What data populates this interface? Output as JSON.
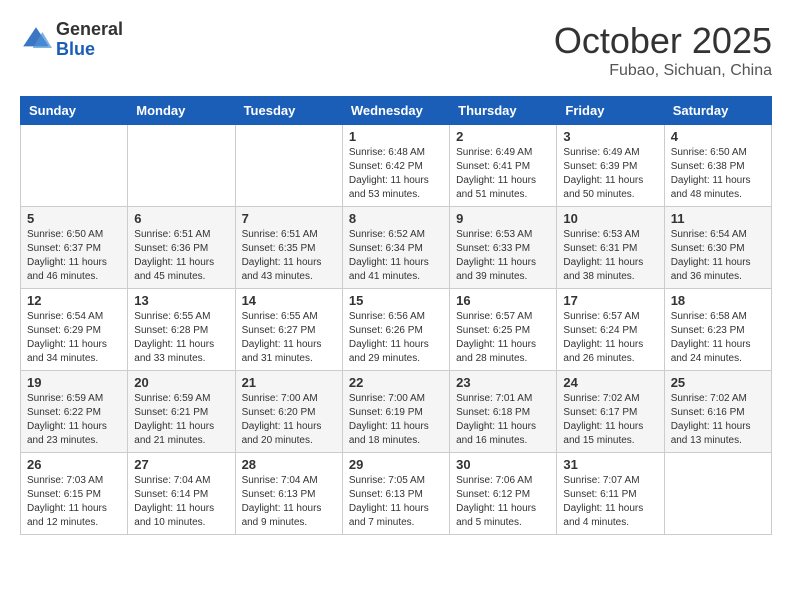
{
  "header": {
    "logo_general": "General",
    "logo_blue": "Blue",
    "title": "October 2025",
    "subtitle": "Fubao, Sichuan, China"
  },
  "days_of_week": [
    "Sunday",
    "Monday",
    "Tuesday",
    "Wednesday",
    "Thursday",
    "Friday",
    "Saturday"
  ],
  "weeks": [
    [
      {
        "day": "",
        "info": ""
      },
      {
        "day": "",
        "info": ""
      },
      {
        "day": "",
        "info": ""
      },
      {
        "day": "1",
        "info": "Sunrise: 6:48 AM\nSunset: 6:42 PM\nDaylight: 11 hours\nand 53 minutes."
      },
      {
        "day": "2",
        "info": "Sunrise: 6:49 AM\nSunset: 6:41 PM\nDaylight: 11 hours\nand 51 minutes."
      },
      {
        "day": "3",
        "info": "Sunrise: 6:49 AM\nSunset: 6:39 PM\nDaylight: 11 hours\nand 50 minutes."
      },
      {
        "day": "4",
        "info": "Sunrise: 6:50 AM\nSunset: 6:38 PM\nDaylight: 11 hours\nand 48 minutes."
      }
    ],
    [
      {
        "day": "5",
        "info": "Sunrise: 6:50 AM\nSunset: 6:37 PM\nDaylight: 11 hours\nand 46 minutes."
      },
      {
        "day": "6",
        "info": "Sunrise: 6:51 AM\nSunset: 6:36 PM\nDaylight: 11 hours\nand 45 minutes."
      },
      {
        "day": "7",
        "info": "Sunrise: 6:51 AM\nSunset: 6:35 PM\nDaylight: 11 hours\nand 43 minutes."
      },
      {
        "day": "8",
        "info": "Sunrise: 6:52 AM\nSunset: 6:34 PM\nDaylight: 11 hours\nand 41 minutes."
      },
      {
        "day": "9",
        "info": "Sunrise: 6:53 AM\nSunset: 6:33 PM\nDaylight: 11 hours\nand 39 minutes."
      },
      {
        "day": "10",
        "info": "Sunrise: 6:53 AM\nSunset: 6:31 PM\nDaylight: 11 hours\nand 38 minutes."
      },
      {
        "day": "11",
        "info": "Sunrise: 6:54 AM\nSunset: 6:30 PM\nDaylight: 11 hours\nand 36 minutes."
      }
    ],
    [
      {
        "day": "12",
        "info": "Sunrise: 6:54 AM\nSunset: 6:29 PM\nDaylight: 11 hours\nand 34 minutes."
      },
      {
        "day": "13",
        "info": "Sunrise: 6:55 AM\nSunset: 6:28 PM\nDaylight: 11 hours\nand 33 minutes."
      },
      {
        "day": "14",
        "info": "Sunrise: 6:55 AM\nSunset: 6:27 PM\nDaylight: 11 hours\nand 31 minutes."
      },
      {
        "day": "15",
        "info": "Sunrise: 6:56 AM\nSunset: 6:26 PM\nDaylight: 11 hours\nand 29 minutes."
      },
      {
        "day": "16",
        "info": "Sunrise: 6:57 AM\nSunset: 6:25 PM\nDaylight: 11 hours\nand 28 minutes."
      },
      {
        "day": "17",
        "info": "Sunrise: 6:57 AM\nSunset: 6:24 PM\nDaylight: 11 hours\nand 26 minutes."
      },
      {
        "day": "18",
        "info": "Sunrise: 6:58 AM\nSunset: 6:23 PM\nDaylight: 11 hours\nand 24 minutes."
      }
    ],
    [
      {
        "day": "19",
        "info": "Sunrise: 6:59 AM\nSunset: 6:22 PM\nDaylight: 11 hours\nand 23 minutes."
      },
      {
        "day": "20",
        "info": "Sunrise: 6:59 AM\nSunset: 6:21 PM\nDaylight: 11 hours\nand 21 minutes."
      },
      {
        "day": "21",
        "info": "Sunrise: 7:00 AM\nSunset: 6:20 PM\nDaylight: 11 hours\nand 20 minutes."
      },
      {
        "day": "22",
        "info": "Sunrise: 7:00 AM\nSunset: 6:19 PM\nDaylight: 11 hours\nand 18 minutes."
      },
      {
        "day": "23",
        "info": "Sunrise: 7:01 AM\nSunset: 6:18 PM\nDaylight: 11 hours\nand 16 minutes."
      },
      {
        "day": "24",
        "info": "Sunrise: 7:02 AM\nSunset: 6:17 PM\nDaylight: 11 hours\nand 15 minutes."
      },
      {
        "day": "25",
        "info": "Sunrise: 7:02 AM\nSunset: 6:16 PM\nDaylight: 11 hours\nand 13 minutes."
      }
    ],
    [
      {
        "day": "26",
        "info": "Sunrise: 7:03 AM\nSunset: 6:15 PM\nDaylight: 11 hours\nand 12 minutes."
      },
      {
        "day": "27",
        "info": "Sunrise: 7:04 AM\nSunset: 6:14 PM\nDaylight: 11 hours\nand 10 minutes."
      },
      {
        "day": "28",
        "info": "Sunrise: 7:04 AM\nSunset: 6:13 PM\nDaylight: 11 hours\nand 9 minutes."
      },
      {
        "day": "29",
        "info": "Sunrise: 7:05 AM\nSunset: 6:13 PM\nDaylight: 11 hours\nand 7 minutes."
      },
      {
        "day": "30",
        "info": "Sunrise: 7:06 AM\nSunset: 6:12 PM\nDaylight: 11 hours\nand 5 minutes."
      },
      {
        "day": "31",
        "info": "Sunrise: 7:07 AM\nSunset: 6:11 PM\nDaylight: 11 hours\nand 4 minutes."
      },
      {
        "day": "",
        "info": ""
      }
    ]
  ]
}
